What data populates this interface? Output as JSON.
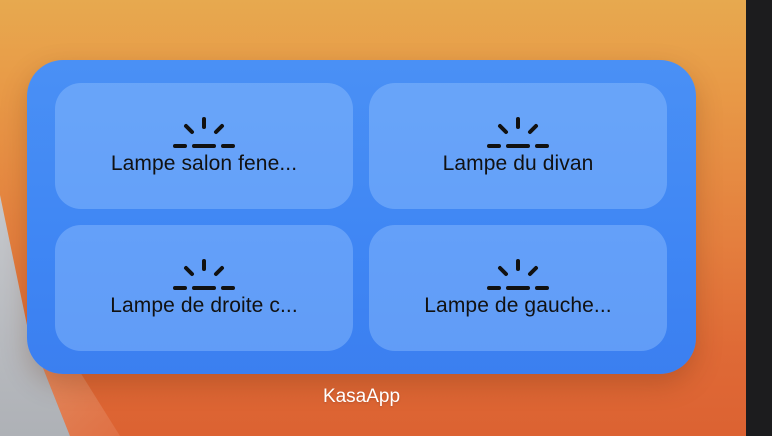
{
  "widget": {
    "app_name": "KasaApp",
    "accent_color": "#3f86f4",
    "devices": [
      {
        "label": "Lampe salon fene...",
        "icon": "light-bulb-icon"
      },
      {
        "label": "Lampe du divan",
        "icon": "light-bulb-icon"
      },
      {
        "label": "Lampe de droite c...",
        "icon": "light-bulb-icon"
      },
      {
        "label": "Lampe de gauche...",
        "icon": "light-bulb-icon"
      }
    ]
  }
}
